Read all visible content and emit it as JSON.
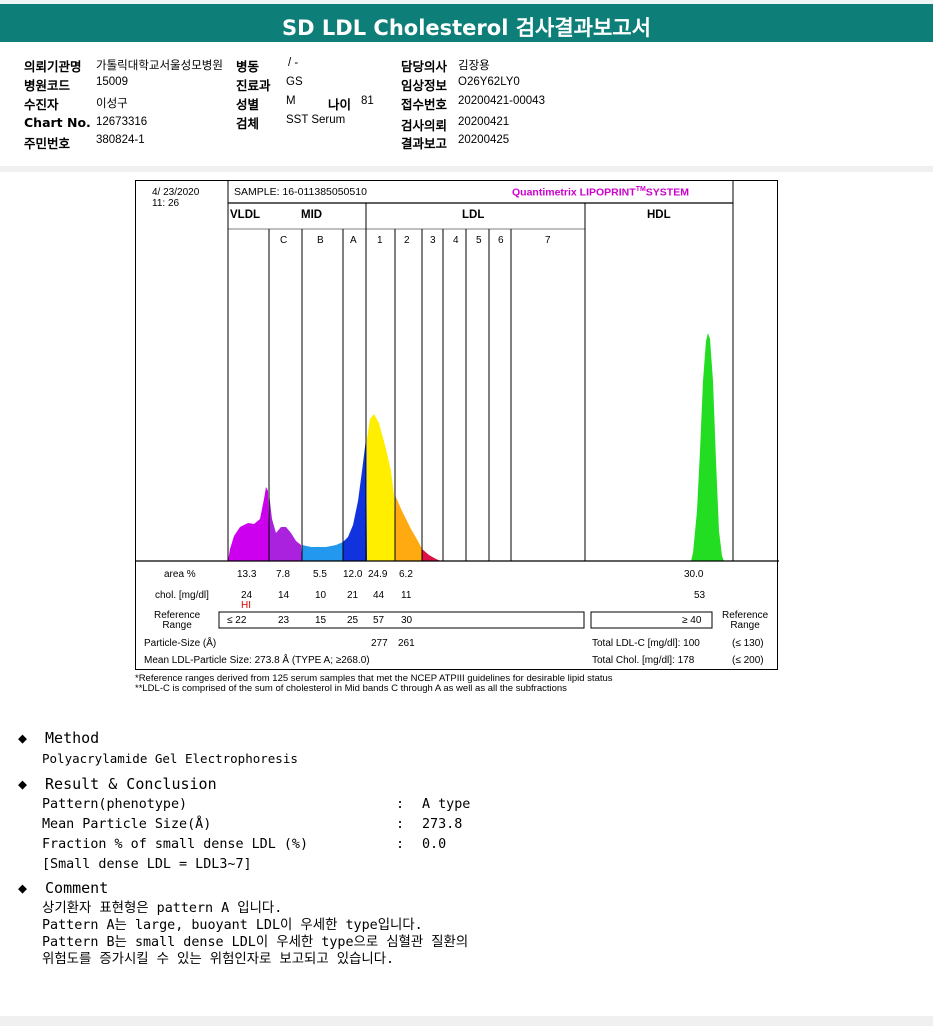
{
  "title": "SD LDL Cholesterol 검사결과보고서",
  "info": {
    "institution_label": "의뢰기관명",
    "institution": "가톨릭대학교서울성모병원",
    "ward_label": "병동",
    "ward": "/ -",
    "doctor_label": "담당의사",
    "doctor": "김장용",
    "hospital_code_label": "병원코드",
    "hospital_code": "15009",
    "dept_label": "진료과",
    "dept": "GS",
    "clinical_label": "임상정보",
    "clinical": "O26Y62LY0",
    "patient_label": "수진자",
    "patient": "이성구",
    "sex_label": "성별",
    "sex": "M",
    "age_label": "나이",
    "age": "81",
    "receipt_label": "접수번호",
    "receipt": "20200421-00043",
    "chart_label": "Chart No.",
    "chart": "12673316",
    "specimen_label": "검체",
    "specimen": "SST Serum",
    "request_label": "검사의뢰",
    "request": "20200421",
    "rrn_label": "주민번호",
    "rrn": "380824-1",
    "report_label": "결과보고",
    "report": "20200425"
  },
  "chart_header": {
    "date": "4/ 23/2020",
    "time": "11: 26",
    "sample": "SAMPLE:   16-011385050510",
    "brand": "Quantimetrix LIPOPRINT",
    "brand_tm": "TM",
    "brand_system": "SYSTEM",
    "accent_color": "#cc00cc"
  },
  "chart_data": {
    "type": "area",
    "groups": [
      "VLDL",
      "MID",
      "LDL",
      "HDL"
    ],
    "band_labels": [
      "C",
      "B",
      "A",
      "1",
      "2",
      "3",
      "4",
      "5",
      "6",
      "7"
    ],
    "fractions": [
      "VLDL",
      "C",
      "B",
      "A",
      "1",
      "2",
      "3",
      "4",
      "5",
      "6",
      "7",
      "HDL"
    ],
    "area_pct": [
      "13.3",
      "7.8",
      "5.5",
      "12.0",
      "24.9",
      "6.2",
      "",
      "",
      "",
      "",
      "",
      "30.0"
    ],
    "chol_mg_dl": [
      "24",
      "14",
      "10",
      "21",
      "44",
      "11",
      "",
      "",
      "",
      "",
      "",
      "53"
    ],
    "hi_flag": "HI",
    "reference": [
      "≤ 22",
      "23",
      "15",
      "25",
      "57",
      "30"
    ],
    "hdl_reference": "≥ 40",
    "particle_size_A": [
      "277",
      "261"
    ],
    "series": [
      {
        "name": "VLDL",
        "color": "#cc00ee"
      },
      {
        "name": "C",
        "color": "#aa22dd"
      },
      {
        "name": "B",
        "color": "#2299ee"
      },
      {
        "name": "A",
        "color": "#1133dd"
      },
      {
        "name": "1",
        "color": "#ffee00"
      },
      {
        "name": "2",
        "color": "#ffaa11"
      },
      {
        "name": "3",
        "color": "#dd1144"
      },
      {
        "name": "HDL",
        "color": "#22dd22"
      }
    ]
  },
  "chart_labels": {
    "area": "area %",
    "chol": "chol. [mg/dl]",
    "ref": "Reference\nRange",
    "ref_right": "Reference\nRange",
    "particle_size": "Particle-Size (Å)",
    "mean_ldl": "Mean LDL-Particle Size:   273.8 Å   (TYPE A; ≥268.0)",
    "total_ldl": "Total LDL-C [mg/dl]:  100",
    "total_ldl_ref": "(≤ 130)",
    "total_chol": "Total Chol. [mg/dl]:   178",
    "total_chol_ref": "(≤ 200)"
  },
  "footnotes": [
    "*Reference ranges derived from 125 serum samples that met the NCEP ATPIII guidelines for desirable lipid status",
    "**LDL-C is comprised of the sum of cholesterol in Mid bands C through A as well as all the subfractions"
  ],
  "method": {
    "heading": "Method",
    "text": "Polyacrylamide Gel Electrophoresis"
  },
  "result": {
    "heading": "Result & Conclusion",
    "rows": [
      {
        "label": "Pattern(phenotype)",
        "value": "A type"
      },
      {
        "label": "Mean Particle Size(Å)",
        "value": "273.8"
      },
      {
        "label": "Fraction % of small dense LDL (%)",
        "value": "0.0"
      }
    ],
    "note": "[Small dense LDL = LDL3~7]"
  },
  "comment": {
    "heading": "Comment",
    "lines": [
      "상기환자 표현형은 pattern A 입니다.",
      "Pattern A는 large, buoyant LDL이 우세한 type입니다.",
      "Pattern B는 small dense LDL이 우세한 type으로 심혈관 질환의",
      "위험도를 증가시킬 수 있는 위험인자로 보고되고 있습니다."
    ]
  }
}
